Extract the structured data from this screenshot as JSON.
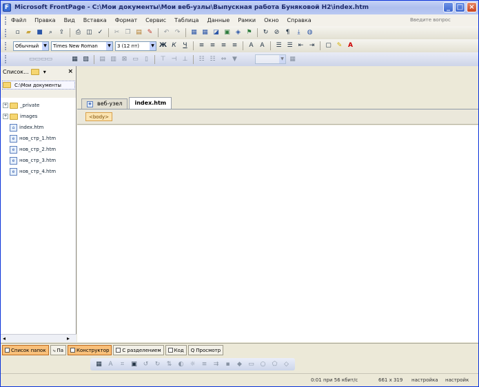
{
  "window": {
    "title": "Microsoft FrontPage - C:\\Мои документы\\Мои веб-узлы\\Выпускная работа Буняковой Н2\\index.htm",
    "app_icon": "frontpage-icon",
    "minimize": "_",
    "maximize": "□",
    "close": "×"
  },
  "menubar": {
    "items": [
      "Файл",
      "Правка",
      "Вид",
      "Вставка",
      "Формат",
      "Сервис",
      "Таблица",
      "Данные",
      "Рамки",
      "Окно",
      "Справка"
    ],
    "ask_question": "Введите вопрос"
  },
  "toolbar_formatting": {
    "style": "Обычный",
    "font": "Times New Roman",
    "size": "3 (12 пт)"
  },
  "folder_pane": {
    "title": "Список...",
    "path": "C:\\Мои документы",
    "items": [
      {
        "label": "_private",
        "type": "folder"
      },
      {
        "label": "images",
        "type": "folder"
      },
      {
        "label": "index.htm",
        "type": "page"
      },
      {
        "label": "нов_стр_1.htm",
        "type": "page"
      },
      {
        "label": "нов_стр_2.htm",
        "type": "page"
      },
      {
        "label": "нов_стр_3.htm",
        "type": "page"
      },
      {
        "label": "нов_стр_4.htm",
        "type": "page"
      }
    ]
  },
  "editor": {
    "tabs": [
      {
        "label": "веб-узел",
        "active": false
      },
      {
        "label": "index.htm",
        "active": true
      }
    ],
    "quick_tag": "<body>"
  },
  "view_tabs": {
    "left": [
      {
        "label": "Список папок",
        "active": true
      },
      {
        "label": "Па",
        "active": false
      }
    ],
    "right": [
      {
        "label": "Конструктор",
        "active": true
      },
      {
        "label": "С разделением",
        "active": false
      },
      {
        "label": "Код",
        "active": false
      },
      {
        "label": "Просмотр",
        "active": false
      }
    ]
  },
  "statusbar": {
    "download_time": "0:01 при 56 кбит/с",
    "dimensions": "661 x 319",
    "mode1": "настройка",
    "mode2": "настройк"
  }
}
